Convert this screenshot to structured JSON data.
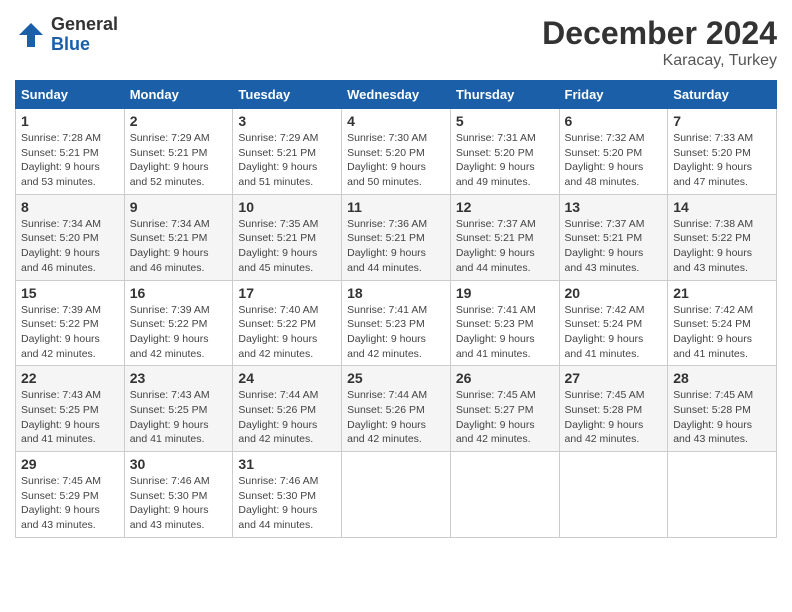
{
  "logo": {
    "general": "General",
    "blue": "Blue"
  },
  "header": {
    "month": "December 2024",
    "location": "Karacay, Turkey"
  },
  "weekdays": [
    "Sunday",
    "Monday",
    "Tuesday",
    "Wednesday",
    "Thursday",
    "Friday",
    "Saturday"
  ],
  "weeks": [
    [
      {
        "day": "1",
        "sunrise": "7:28 AM",
        "sunset": "5:21 PM",
        "daylight": "9 hours and 53 minutes."
      },
      {
        "day": "2",
        "sunrise": "7:29 AM",
        "sunset": "5:21 PM",
        "daylight": "9 hours and 52 minutes."
      },
      {
        "day": "3",
        "sunrise": "7:29 AM",
        "sunset": "5:21 PM",
        "daylight": "9 hours and 51 minutes."
      },
      {
        "day": "4",
        "sunrise": "7:30 AM",
        "sunset": "5:20 PM",
        "daylight": "9 hours and 50 minutes."
      },
      {
        "day": "5",
        "sunrise": "7:31 AM",
        "sunset": "5:20 PM",
        "daylight": "9 hours and 49 minutes."
      },
      {
        "day": "6",
        "sunrise": "7:32 AM",
        "sunset": "5:20 PM",
        "daylight": "9 hours and 48 minutes."
      },
      {
        "day": "7",
        "sunrise": "7:33 AM",
        "sunset": "5:20 PM",
        "daylight": "9 hours and 47 minutes."
      }
    ],
    [
      {
        "day": "8",
        "sunrise": "7:34 AM",
        "sunset": "5:20 PM",
        "daylight": "9 hours and 46 minutes."
      },
      {
        "day": "9",
        "sunrise": "7:34 AM",
        "sunset": "5:21 PM",
        "daylight": "9 hours and 46 minutes."
      },
      {
        "day": "10",
        "sunrise": "7:35 AM",
        "sunset": "5:21 PM",
        "daylight": "9 hours and 45 minutes."
      },
      {
        "day": "11",
        "sunrise": "7:36 AM",
        "sunset": "5:21 PM",
        "daylight": "9 hours and 44 minutes."
      },
      {
        "day": "12",
        "sunrise": "7:37 AM",
        "sunset": "5:21 PM",
        "daylight": "9 hours and 44 minutes."
      },
      {
        "day": "13",
        "sunrise": "7:37 AM",
        "sunset": "5:21 PM",
        "daylight": "9 hours and 43 minutes."
      },
      {
        "day": "14",
        "sunrise": "7:38 AM",
        "sunset": "5:22 PM",
        "daylight": "9 hours and 43 minutes."
      }
    ],
    [
      {
        "day": "15",
        "sunrise": "7:39 AM",
        "sunset": "5:22 PM",
        "daylight": "9 hours and 42 minutes."
      },
      {
        "day": "16",
        "sunrise": "7:39 AM",
        "sunset": "5:22 PM",
        "daylight": "9 hours and 42 minutes."
      },
      {
        "day": "17",
        "sunrise": "7:40 AM",
        "sunset": "5:22 PM",
        "daylight": "9 hours and 42 minutes."
      },
      {
        "day": "18",
        "sunrise": "7:41 AM",
        "sunset": "5:23 PM",
        "daylight": "9 hours and 42 minutes."
      },
      {
        "day": "19",
        "sunrise": "7:41 AM",
        "sunset": "5:23 PM",
        "daylight": "9 hours and 41 minutes."
      },
      {
        "day": "20",
        "sunrise": "7:42 AM",
        "sunset": "5:24 PM",
        "daylight": "9 hours and 41 minutes."
      },
      {
        "day": "21",
        "sunrise": "7:42 AM",
        "sunset": "5:24 PM",
        "daylight": "9 hours and 41 minutes."
      }
    ],
    [
      {
        "day": "22",
        "sunrise": "7:43 AM",
        "sunset": "5:25 PM",
        "daylight": "9 hours and 41 minutes."
      },
      {
        "day": "23",
        "sunrise": "7:43 AM",
        "sunset": "5:25 PM",
        "daylight": "9 hours and 41 minutes."
      },
      {
        "day": "24",
        "sunrise": "7:44 AM",
        "sunset": "5:26 PM",
        "daylight": "9 hours and 42 minutes."
      },
      {
        "day": "25",
        "sunrise": "7:44 AM",
        "sunset": "5:26 PM",
        "daylight": "9 hours and 42 minutes."
      },
      {
        "day": "26",
        "sunrise": "7:45 AM",
        "sunset": "5:27 PM",
        "daylight": "9 hours and 42 minutes."
      },
      {
        "day": "27",
        "sunrise": "7:45 AM",
        "sunset": "5:28 PM",
        "daylight": "9 hours and 42 minutes."
      },
      {
        "day": "28",
        "sunrise": "7:45 AM",
        "sunset": "5:28 PM",
        "daylight": "9 hours and 43 minutes."
      }
    ],
    [
      {
        "day": "29",
        "sunrise": "7:45 AM",
        "sunset": "5:29 PM",
        "daylight": "9 hours and 43 minutes."
      },
      {
        "day": "30",
        "sunrise": "7:46 AM",
        "sunset": "5:30 PM",
        "daylight": "9 hours and 43 minutes."
      },
      {
        "day": "31",
        "sunrise": "7:46 AM",
        "sunset": "5:30 PM",
        "daylight": "9 hours and 44 minutes."
      },
      null,
      null,
      null,
      null
    ]
  ],
  "labels": {
    "sunrise": "Sunrise:",
    "sunset": "Sunset:",
    "daylight": "Daylight:"
  }
}
